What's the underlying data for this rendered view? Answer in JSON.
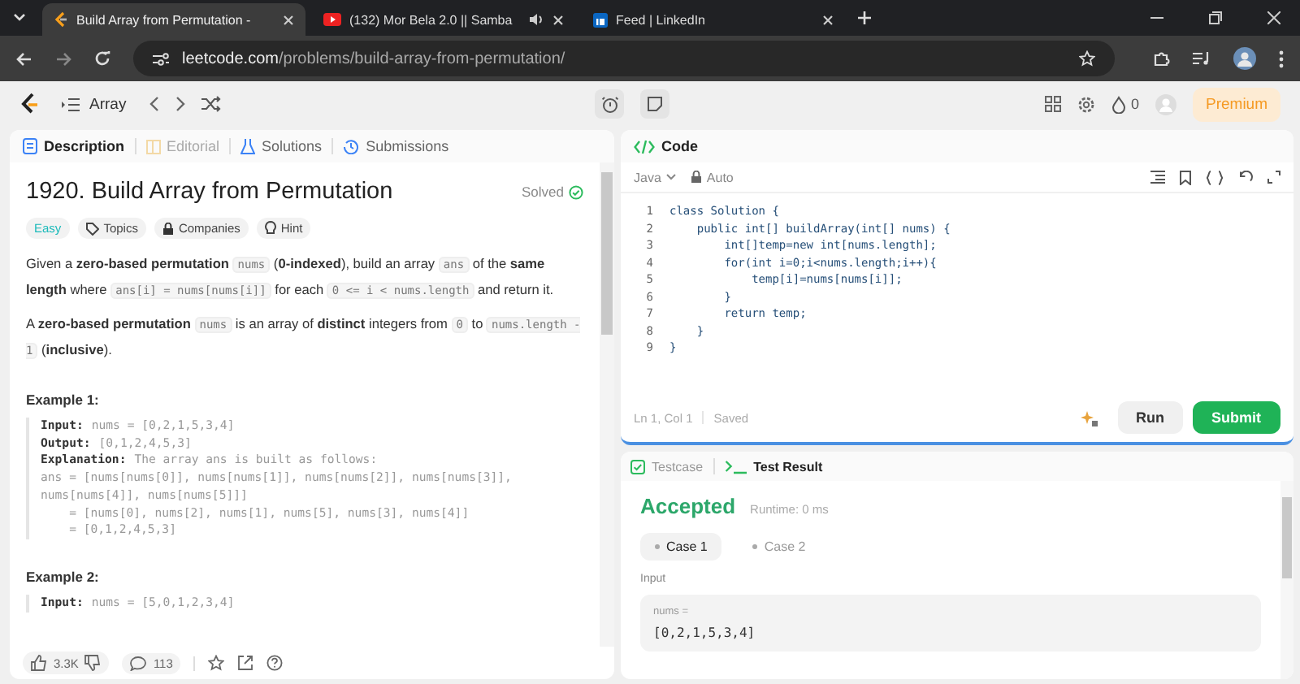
{
  "browser_tabs": [
    {
      "title": "Build Array from Permutation -",
      "kind": "leetcode",
      "selected": true,
      "playing_audio": false
    },
    {
      "title": "(132) Mor Bela 2.0 || Samba",
      "kind": "video",
      "selected": false,
      "playing_audio": true
    },
    {
      "title": "Feed | LinkedIn",
      "kind": "social",
      "selected": false,
      "playing_audio": false
    }
  ],
  "address": {
    "domain": "leetcode.com",
    "path": "/problems/build-array-from-permutation/"
  },
  "nav": {
    "list_label": "Array",
    "streak": "0",
    "premium": "Premium"
  },
  "description_tabs": [
    {
      "label": "Description",
      "kind": "description",
      "selected": true,
      "disabled": false
    },
    {
      "label": "Editorial",
      "kind": "editorial",
      "selected": false,
      "disabled": true
    },
    {
      "label": "Solutions",
      "kind": "solutions",
      "selected": false,
      "disabled": false
    },
    {
      "label": "Submissions",
      "kind": "submissions",
      "selected": false,
      "disabled": false
    }
  ],
  "problem": {
    "title": "1920. Build Array from Permutation",
    "status": "Solved",
    "tags": [
      {
        "label": "Easy",
        "kind": "difficulty"
      },
      {
        "label": "Topics",
        "kind": "topics"
      },
      {
        "label": "Companies",
        "kind": "companies"
      },
      {
        "label": "Hint",
        "kind": "hint"
      }
    ],
    "paragraphs": [
      [
        {
          "kind": "text",
          "text": "Given a **zero-based permutation** "
        },
        {
          "kind": "code",
          "text": "nums"
        },
        {
          "kind": "text",
          "text": " (**0-indexed**), build an array "
        },
        {
          "kind": "code",
          "text": "ans"
        },
        {
          "kind": "text",
          "text": " of the **same length** where "
        },
        {
          "kind": "code",
          "text": "ans[i] = nums[nums[i]]"
        },
        {
          "kind": "text",
          "text": " for each "
        },
        {
          "kind": "code",
          "text": "0 <= i < nums.length"
        },
        {
          "kind": "text",
          "text": " and return it."
        }
      ],
      [
        {
          "kind": "text",
          "text": "A **zero-based permutation** "
        },
        {
          "kind": "code",
          "text": "nums"
        },
        {
          "kind": "text",
          "text": " is an array of **distinct** integers from "
        },
        {
          "kind": "code",
          "text": "0"
        },
        {
          "kind": "text",
          "text": " to "
        },
        {
          "kind": "code",
          "text": "nums.length - 1"
        },
        {
          "kind": "text",
          "text": " (**inclusive**)."
        }
      ]
    ],
    "examples": [
      {
        "title": "Example 1:",
        "lines": [
          {
            "label": "Input:",
            "text": "nums = [0,2,1,5,3,4]"
          },
          {
            "label": "Output:",
            "text": "[0,1,2,4,5,3]"
          },
          {
            "label": "Explanation:",
            "text": "The array ans is built as follows:"
          },
          {
            "text": "ans = [nums[nums[0]], nums[nums[1]], nums[nums[2]], nums[nums[3]],"
          },
          {
            "text": "nums[nums[4]], nums[nums[5]]]"
          },
          {
            "text": "    = [nums[0], nums[2], nums[1], nums[5], nums[3], nums[4]]"
          },
          {
            "text": "    = [0,1,2,4,5,3]"
          }
        ]
      },
      {
        "title": "Example 2:",
        "lines": [
          {
            "label": "Input:",
            "text": "nums = [5,0,1,2,3,4]"
          }
        ]
      }
    ]
  },
  "footer": {
    "likes": "3.3K",
    "comments": "113"
  },
  "editor": {
    "title": "Code",
    "language": "Java",
    "mode": "Auto",
    "lines": [
      {
        "number": "1",
        "text": "class Solution {"
      },
      {
        "number": "2",
        "text": "    public int[] buildArray(int[] nums) {"
      },
      {
        "number": "3",
        "text": "        int[]temp=new int[nums.length];"
      },
      {
        "number": "4",
        "text": "        for(int i=0;i<nums.length;i++){"
      },
      {
        "number": "5",
        "text": "            temp[i]=nums[nums[i]];"
      },
      {
        "number": "6",
        "text": "        }"
      },
      {
        "number": "7",
        "text": "        return temp;"
      },
      {
        "number": "8",
        "text": "    }"
      },
      {
        "number": "9",
        "text": "}"
      }
    ],
    "position": "Ln 1, Col 1",
    "save_state": "Saved",
    "run": "Run",
    "submit": "Submit"
  },
  "console": {
    "tabs": [
      {
        "label": "Testcase",
        "kind": "testcase",
        "selected": false
      },
      {
        "label": "Test Result",
        "kind": "result",
        "selected": true
      }
    ],
    "verdict": "Accepted",
    "runtime": "Runtime: 0 ms",
    "cases": [
      {
        "label": "Case 1",
        "selected": true
      },
      {
        "label": "Case 2",
        "selected": false
      }
    ],
    "input_label": "Input",
    "variable": "nums =",
    "value": "[0,2,1,5,3,4]"
  }
}
